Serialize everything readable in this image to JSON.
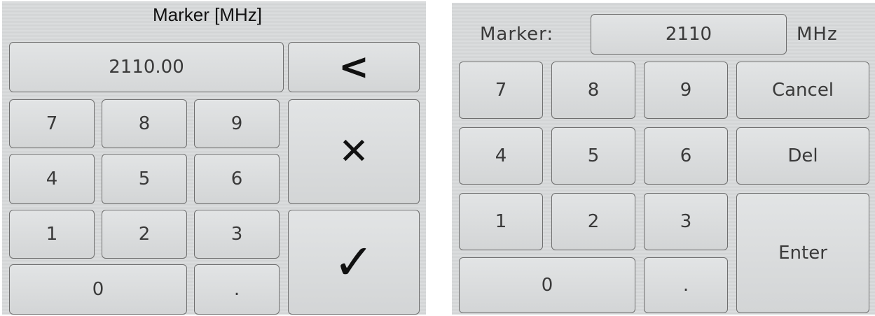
{
  "left_keypad": {
    "title": "Marker [MHz]",
    "value": "2110.00",
    "keys": {
      "k7": "7",
      "k8": "8",
      "k9": "9",
      "k4": "4",
      "k5": "5",
      "k6": "6",
      "k1": "1",
      "k2": "2",
      "k3": "3",
      "k0": "0",
      "kdot": "."
    },
    "backspace_glyph": "<",
    "cancel_glyph": "✕",
    "confirm_glyph": "✓"
  },
  "right_keypad": {
    "label": "Marker:",
    "value": "2110",
    "unit": "MHz",
    "keys": {
      "k7": "7",
      "k8": "8",
      "k9": "9",
      "k4": "4",
      "k5": "5",
      "k6": "6",
      "k1": "1",
      "k2": "2",
      "k3": "3",
      "k0": "0",
      "kdot": "."
    },
    "cancel_label": "Cancel",
    "del_label": "Del",
    "enter_label": "Enter"
  }
}
